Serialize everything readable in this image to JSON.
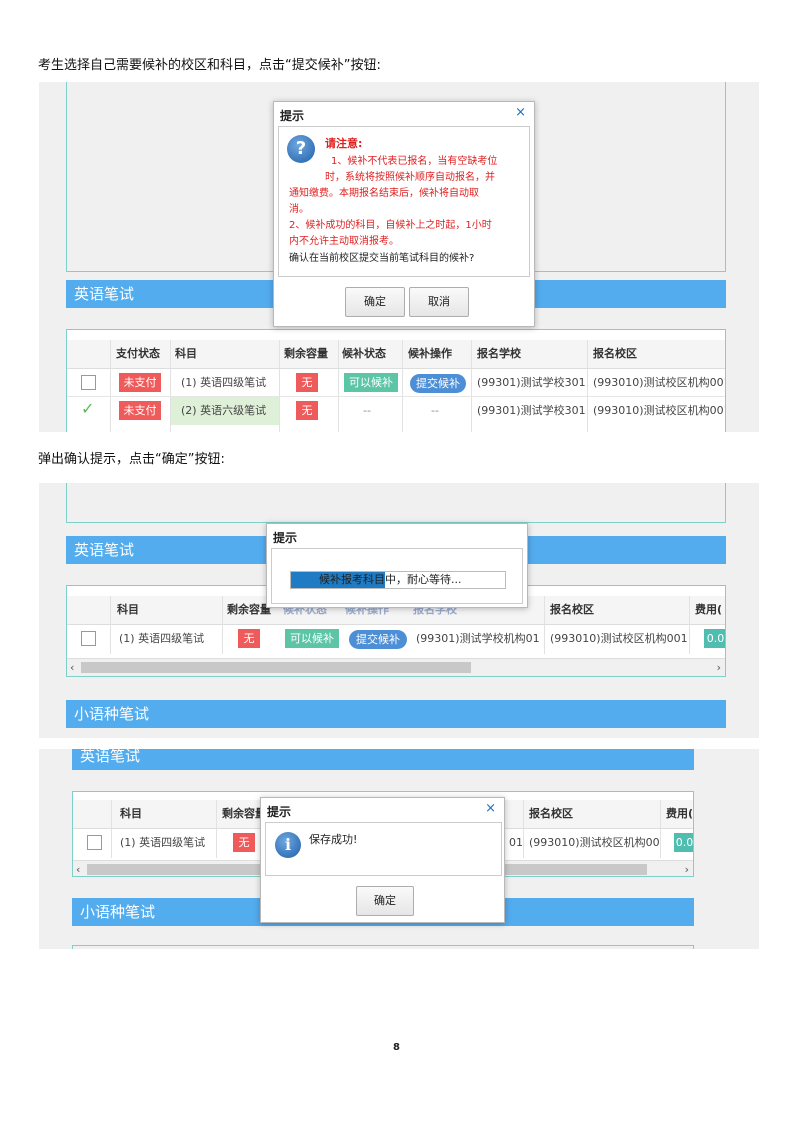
{
  "paragraphs": {
    "p1": "考生选择自己需要候补的校区和科目，点击“提交候补”按钮:",
    "p2": "弹出确认提示，点击“确定”按钮:"
  },
  "page_number": "8",
  "common": {
    "dialog_title": "提示",
    "close_icon": "×",
    "section_english": "英语笔试",
    "section_minor": "小语种笔试",
    "ok": "确定",
    "cancel": "取消",
    "scroll_left": "‹",
    "scroll_right": "›"
  },
  "shot1": {
    "headers": [
      "支付状态",
      "科目",
      "剩余容量",
      "候补状态",
      "候补操作",
      "报名学校",
      "报名校区"
    ],
    "rows": [
      {
        "check": "",
        "pay": "未支付",
        "subject": "(1) 英语四级笔试",
        "remain": "无",
        "status": "可以候补",
        "op": "提交候补",
        "school": "(99301)测试学校301",
        "campus": "(993010)测试校区机构001"
      },
      {
        "check": "✓",
        "pay": "未支付",
        "subject": "(2) 英语六级笔试",
        "remain": "无",
        "status": "--",
        "op": "--",
        "school": "(99301)测试学校301",
        "campus": "(993010)测试校区机构001"
      }
    ],
    "dialog": {
      "icon": "question-icon",
      "heading": "请注意:",
      "line1": "1、候补不代表已报名，当有空缺考位",
      "line2": "时，系统将按照候补顺序自动报名，并",
      "line3": "通知缴费。本期报名结束后，候补将自动取",
      "line4": "消。",
      "line5": "2、候补成功的科目，自候补上之时起，1小时",
      "line6": "内不允许主动取消报考。",
      "confirm": "确认在当前校区提交当前笔试科目的候补?"
    }
  },
  "shot2": {
    "headers": [
      "科目",
      "剩余容量",
      "候补状态",
      "候补操作",
      "报名学校",
      "报名校区",
      "费用("
    ],
    "row": {
      "subject": "(1) 英语四级笔试",
      "remain": "无",
      "status": "可以候补",
      "op": "提交候补",
      "school": "(99301)测试学校机构01",
      "campus": "(993010)测试校区机构001",
      "fee": "0.0"
    },
    "progress_text": "候补报考科目中，耐心等待...",
    "progress": 0.44
  },
  "shot3": {
    "headers": [
      "科目",
      "剩余容量",
      "报名校区",
      "费用("
    ],
    "row": {
      "subject": "(1) 英语四级笔试",
      "remain": "无",
      "school_tail": "01",
      "campus": "(993010)测试校区机构001",
      "fee": "0.0"
    },
    "dialog": {
      "icon": "info-icon",
      "message": "保存成功!"
    }
  }
}
